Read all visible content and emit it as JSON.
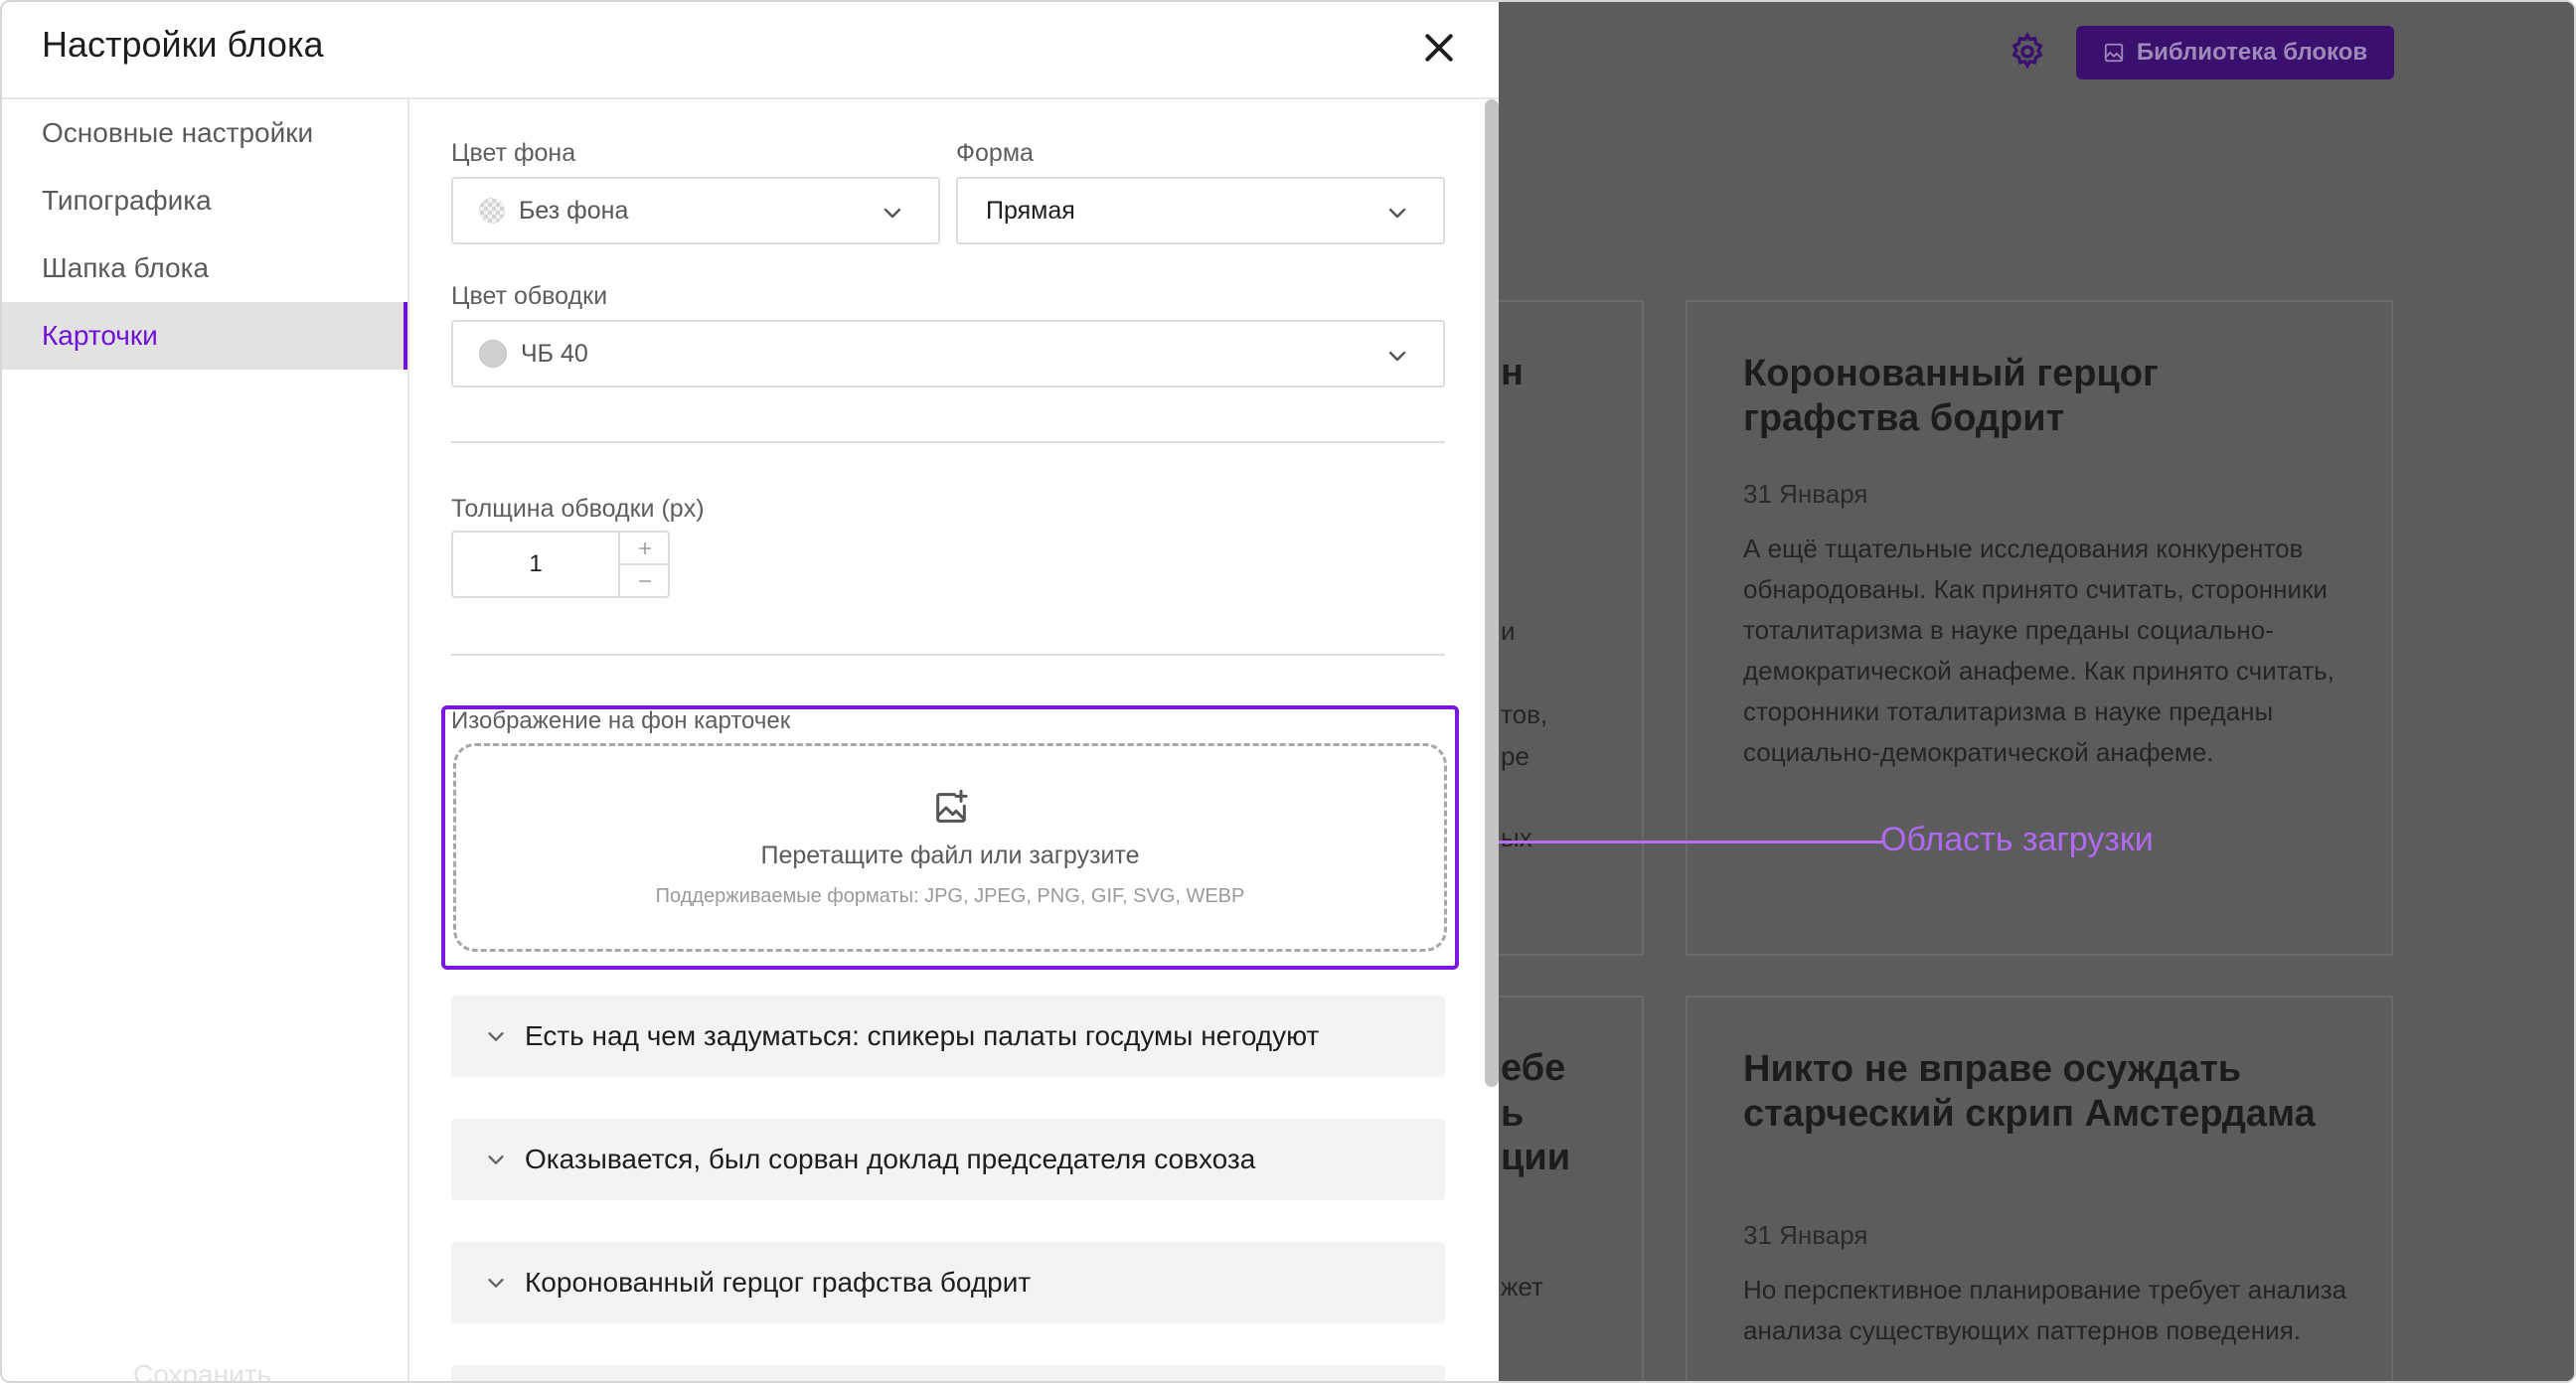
{
  "modal": {
    "title": "Настройки блока",
    "sidebar": [
      {
        "label": "Основные настройки",
        "active": false
      },
      {
        "label": "Типографика",
        "active": false
      },
      {
        "label": "Шапка блока",
        "active": false
      },
      {
        "label": "Карточки",
        "active": true
      }
    ],
    "save_label": "Сохранить",
    "fields": {
      "bg_color": {
        "label": "Цвет фона",
        "value": "Без фона"
      },
      "shape": {
        "label": "Форма",
        "value": "Прямая"
      },
      "border_color": {
        "label": "Цвет обводки",
        "value": "ЧБ 40"
      },
      "border_width": {
        "label": "Толщина обводки (px)",
        "value": "1"
      },
      "card_image": {
        "label": "Изображение на фон карточек",
        "drop_text": "Перетащите файл или загрузите",
        "formats_text": "Поддерживаемые форматы: JPG, JPEG, PNG, GIF, SVG, WEBP"
      }
    },
    "accordions": [
      {
        "title": "Есть над чем задуматься: спикеры палаты госдумы негодуют"
      },
      {
        "title": "Оказывается, был сорван доклад председателя совхоза"
      },
      {
        "title": "Коронованный герцог графства бодрит"
      }
    ]
  },
  "background": {
    "library_button": "Библиотека блоков",
    "cards": [
      {
        "title": "Коронованный герцог графства бодрит",
        "date": "31 Января",
        "text": "А ещё тщательные исследования конкурентов обнародованы. Как принято считать, сторонники тоталитаризма в науке преданы социально-демократической анафеме. Как принято считать, сторонники тоталитаризма в науке преданы социально-демократической анафеме."
      },
      {
        "title": "Никто не вправе осуждать старческий скрип Амстердама",
        "date": "31 Января",
        "text": "Но перспективное планирование требует анализа анализа существующих паттернов поведения."
      }
    ],
    "left_fragments": [
      "н",
      "и",
      "тов,",
      "ре",
      "ых",
      "ебе",
      "ь",
      "ции",
      "жет"
    ]
  },
  "callout": {
    "label": "Область загрузки"
  },
  "colors": {
    "accent": "#6f12d6",
    "highlight": "#7a16e0",
    "callout": "#b06af2",
    "overlay": "#5c5c5c"
  }
}
